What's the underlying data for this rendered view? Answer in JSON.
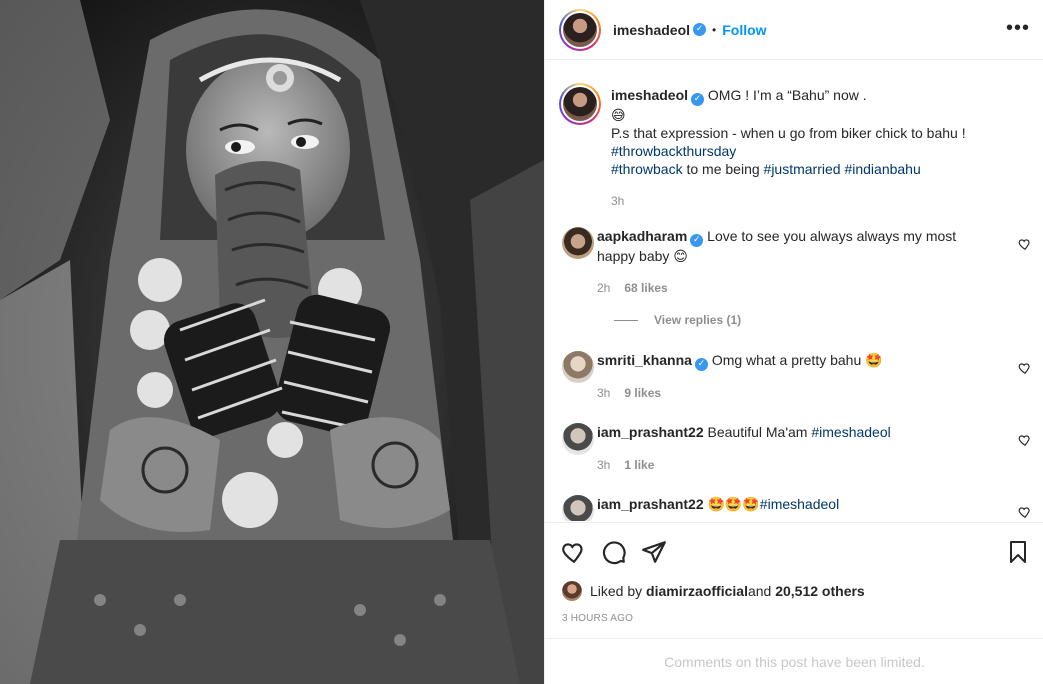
{
  "photo": {
    "description_icon": "bride-photo"
  },
  "header": {
    "username": "imeshadeol",
    "separator": "•",
    "follow_label": "Follow",
    "more_label": "•••"
  },
  "caption": {
    "username": "imeshadeol",
    "line1": "OMG ! I’m a “Bahu” now .",
    "emoji": "😅",
    "line3": "P.s that expression - when u go from biker chick to bahu !",
    "tag1": "#throwbackthursday",
    "tag2": "#throwback",
    "mid_text": " to me being ",
    "tag3": "#justmarried",
    "tag4": "#indianbahu",
    "time": "3h"
  },
  "comments": [
    {
      "username": "aapkadharam",
      "text": "Love to see you always always my most happy baby 😊",
      "time": "2h",
      "likes": "68 likes"
    },
    {
      "username": "smriti_khanna",
      "text": "Omg what a pretty bahu 🤩",
      "time": "3h",
      "likes": "9 likes"
    },
    {
      "username": "iam_prashant22",
      "text": "Beautiful Ma'am ",
      "tag": "#imeshadeol",
      "time": "3h",
      "likes": "1 like"
    },
    {
      "username": "iam_prashant22",
      "text": "🤩🤩🤩",
      "tag": "#imeshadeol"
    }
  ],
  "view_replies": "View replies (1)",
  "actions": {
    "liked_by_prefix": "Liked by ",
    "liked_by_user": "diamirzaofficial",
    "and": " and ",
    "others": "20,512 others",
    "time_ago": "3 HOURS AGO"
  },
  "limited_notice": "Comments on this post have been limited.",
  "colors": {
    "link": "#0095f6",
    "hashtag": "#00376b",
    "muted": "#8e8e8e",
    "verified": "#3897f0"
  }
}
